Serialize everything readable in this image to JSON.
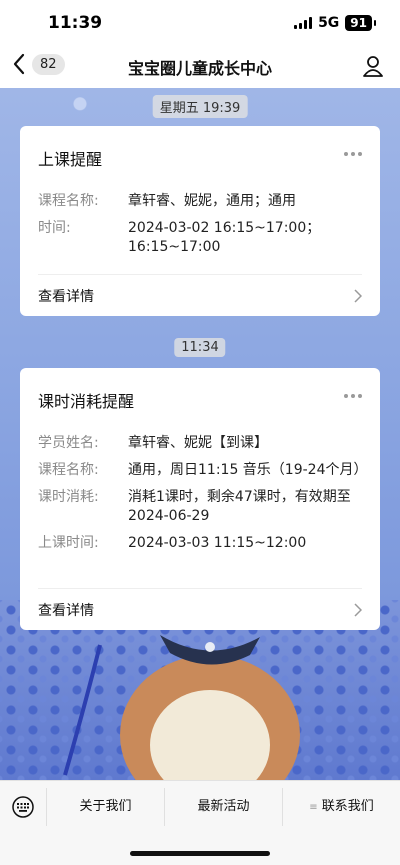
{
  "status_bar": {
    "time": "11:39",
    "network": "5G",
    "battery": "91"
  },
  "nav": {
    "unread_count": "82",
    "title": "宝宝圈儿童成长中心"
  },
  "messages": [
    {
      "timestamp": "星期五 19:39",
      "card": {
        "title": "上课提醒",
        "rows": [
          {
            "label": "课程名称:",
            "value": "章轩睿、妮妮，通用；通用"
          },
          {
            "label": "时间:",
            "value": "2024-03-02 16:15~17:00；16:15~17:00"
          }
        ],
        "footer": "查看详情"
      }
    },
    {
      "timestamp": "11:34",
      "card": {
        "title": "课时消耗提醒",
        "rows": [
          {
            "label": "学员姓名:",
            "value": "章轩睿、妮妮【到课】"
          },
          {
            "label": "课程名称:",
            "value": "通用，周日11:15 音乐（19-24个月）"
          },
          {
            "label": "课时消耗:",
            "value": "消耗1课时，剩余47课时，有效期至2024-06-29"
          },
          {
            "label": "上课时间:",
            "value": "2024-03-03 11:15~12:00"
          }
        ],
        "footer": "查看详情"
      }
    }
  ],
  "bottom_menu": {
    "items": [
      "关于我们",
      "最新活动",
      "联系我们"
    ]
  },
  "icons": {
    "back": "chevron-left-icon",
    "profile": "person-icon",
    "more": "ellipsis-icon",
    "keyboard": "keyboard-icon"
  }
}
